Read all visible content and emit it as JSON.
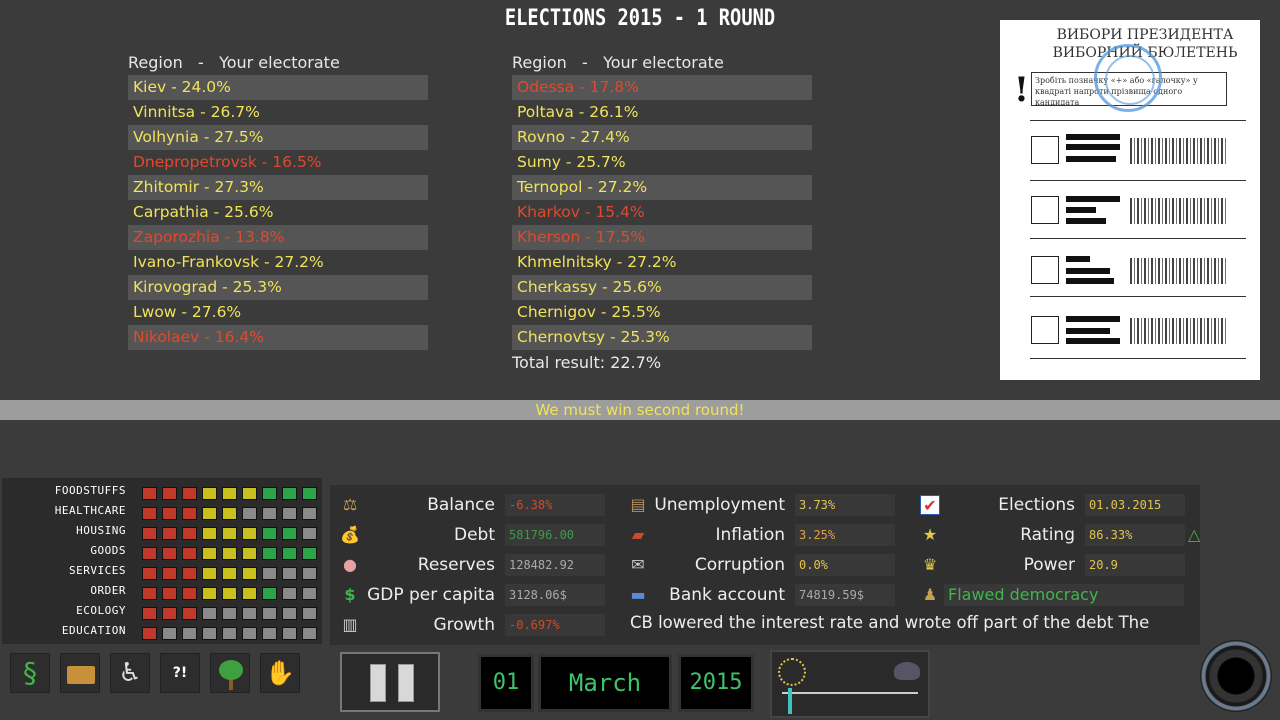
{
  "title": "ELECTIONS 2015 - 1 ROUND",
  "left_column": {
    "header": "Region   -   Your electorate",
    "rows": [
      {
        "text": "Kiev - 24.0%",
        "status": "ok"
      },
      {
        "text": "Vinnitsa - 26.7%",
        "status": "ok"
      },
      {
        "text": "Volhynia - 27.5%",
        "status": "ok"
      },
      {
        "text": "Dnepropetrovsk - 16.5%",
        "status": "bad"
      },
      {
        "text": "Zhitomir - 27.3%",
        "status": "ok"
      },
      {
        "text": "Carpathia - 25.6%",
        "status": "ok"
      },
      {
        "text": "Zaporozhia - 13.8%",
        "status": "bad"
      },
      {
        "text": "Ivano-Frankovsk - 27.2%",
        "status": "ok"
      },
      {
        "text": "Kirovograd - 25.3%",
        "status": "ok"
      },
      {
        "text": "Lwow - 27.6%",
        "status": "ok"
      },
      {
        "text": "Nikolaev - 16.4%",
        "status": "bad"
      }
    ]
  },
  "right_column": {
    "header": "Region   -   Your electorate",
    "rows": [
      {
        "text": "Odessa - 17.8%",
        "status": "bad"
      },
      {
        "text": "Poltava - 26.1%",
        "status": "ok"
      },
      {
        "text": "Rovno - 27.4%",
        "status": "ok"
      },
      {
        "text": "Sumy - 25.7%",
        "status": "ok"
      },
      {
        "text": "Ternopol - 27.2%",
        "status": "ok"
      },
      {
        "text": "Kharkov - 15.4%",
        "status": "bad"
      },
      {
        "text": "Kherson - 17.5%",
        "status": "bad"
      },
      {
        "text": "Khmelnitsky - 27.2%",
        "status": "ok"
      },
      {
        "text": "Cherkassy - 25.6%",
        "status": "ok"
      },
      {
        "text": "Chernigov - 25.5%",
        "status": "ok"
      },
      {
        "text": "Chernovtsy - 25.3%",
        "status": "ok"
      }
    ],
    "total": "Total result: 22.7%"
  },
  "ballot": {
    "title_line1": "ВИБОРИ ПРЕЗИДЕНТА",
    "title_line2": "ВИБОРНИЙ БЮЛЕТЕНЬ",
    "note": "Зробіть позначку «+» або «галочку» у квадраті напроти прізвища одного кандидата",
    "excl": "!"
  },
  "banner": "We must win second round!",
  "meters": [
    {
      "label": "FOODSTUFFS",
      "cells": [
        "r",
        "r",
        "r",
        "y",
        "y",
        "y",
        "g",
        "g",
        "g"
      ]
    },
    {
      "label": "HEALTHCARE",
      "cells": [
        "r",
        "r",
        "r",
        "y",
        "y",
        "n",
        "n",
        "n",
        "n"
      ]
    },
    {
      "label": "HOUSING",
      "cells": [
        "r",
        "r",
        "r",
        "y",
        "y",
        "y",
        "g",
        "g",
        "n"
      ]
    },
    {
      "label": "GOODS",
      "cells": [
        "r",
        "r",
        "r",
        "y",
        "y",
        "y",
        "g",
        "g",
        "g"
      ]
    },
    {
      "label": "SERVICES",
      "cells": [
        "r",
        "r",
        "r",
        "y",
        "y",
        "y",
        "n",
        "n",
        "n"
      ]
    },
    {
      "label": "ORDER",
      "cells": [
        "r",
        "r",
        "r",
        "y",
        "y",
        "y",
        "g",
        "n",
        "n"
      ]
    },
    {
      "label": "ECOLOGY",
      "cells": [
        "r",
        "r",
        "r",
        "n",
        "n",
        "n",
        "n",
        "n",
        "n"
      ]
    },
    {
      "label": "EDUCATION",
      "cells": [
        "r",
        "n",
        "n",
        "n",
        "n",
        "n",
        "n",
        "n",
        "n"
      ]
    }
  ],
  "meter_colors": {
    "r": "#c0392b",
    "y": "#c9c020",
    "g": "#2ea34a",
    "n": "#8a8a8a"
  },
  "stats": {
    "balance": {
      "label": "Balance",
      "value": "-6.38%",
      "color": "#d04a2a",
      "icon": "scales-icon"
    },
    "debt": {
      "label": "Debt",
      "value": "581796.00",
      "color": "#3f9a4a",
      "icon": "money-bag-icon"
    },
    "reserves": {
      "label": "Reserves",
      "value": "128482.92",
      "color": "#aaaaaa",
      "icon": "piggy-bank-icon"
    },
    "gdp": {
      "label": "GDP per capita",
      "value": "3128.06$",
      "color": "#aaaaaa",
      "icon": "dollar-icon"
    },
    "growth": {
      "label": "Growth",
      "value": "-0.697%",
      "color": "#d04a2a",
      "icon": "chart-icon"
    },
    "unemployment": {
      "label": "Unemployment",
      "value": "3.73%",
      "color": "#e3c64a",
      "icon": "unemployed-sign-icon"
    },
    "inflation": {
      "label": "Inflation",
      "value": "3.25%",
      "color": "#e3a040",
      "icon": "inflation-icon"
    },
    "corruption": {
      "label": "Corruption",
      "value": "0.0%",
      "color": "#e3c64a",
      "icon": "envelope-icon"
    },
    "bank": {
      "label": "Bank account",
      "value": "74819.59$",
      "color": "#aaaaaa",
      "icon": "card-icon"
    },
    "elections": {
      "label": "Elections",
      "value": "01.03.2015",
      "color": "#e3c64a",
      "icon": "checkbox-icon"
    },
    "rating": {
      "label": "Rating",
      "value": "86.33%",
      "color": "#e3c64a",
      "icon": "star-icon",
      "trend": "△"
    },
    "power": {
      "label": "Power",
      "value": "20.9",
      "color": "#e3c64a",
      "icon": "crown-icon"
    },
    "regime": {
      "value": "Flawed democracy",
      "color": "#3fb54a",
      "icon": "person-icon"
    }
  },
  "news": "CB lowered the interest rate and wrote off part of the debt      The",
  "date": {
    "day": "01",
    "month": "March",
    "year": "2015"
  }
}
